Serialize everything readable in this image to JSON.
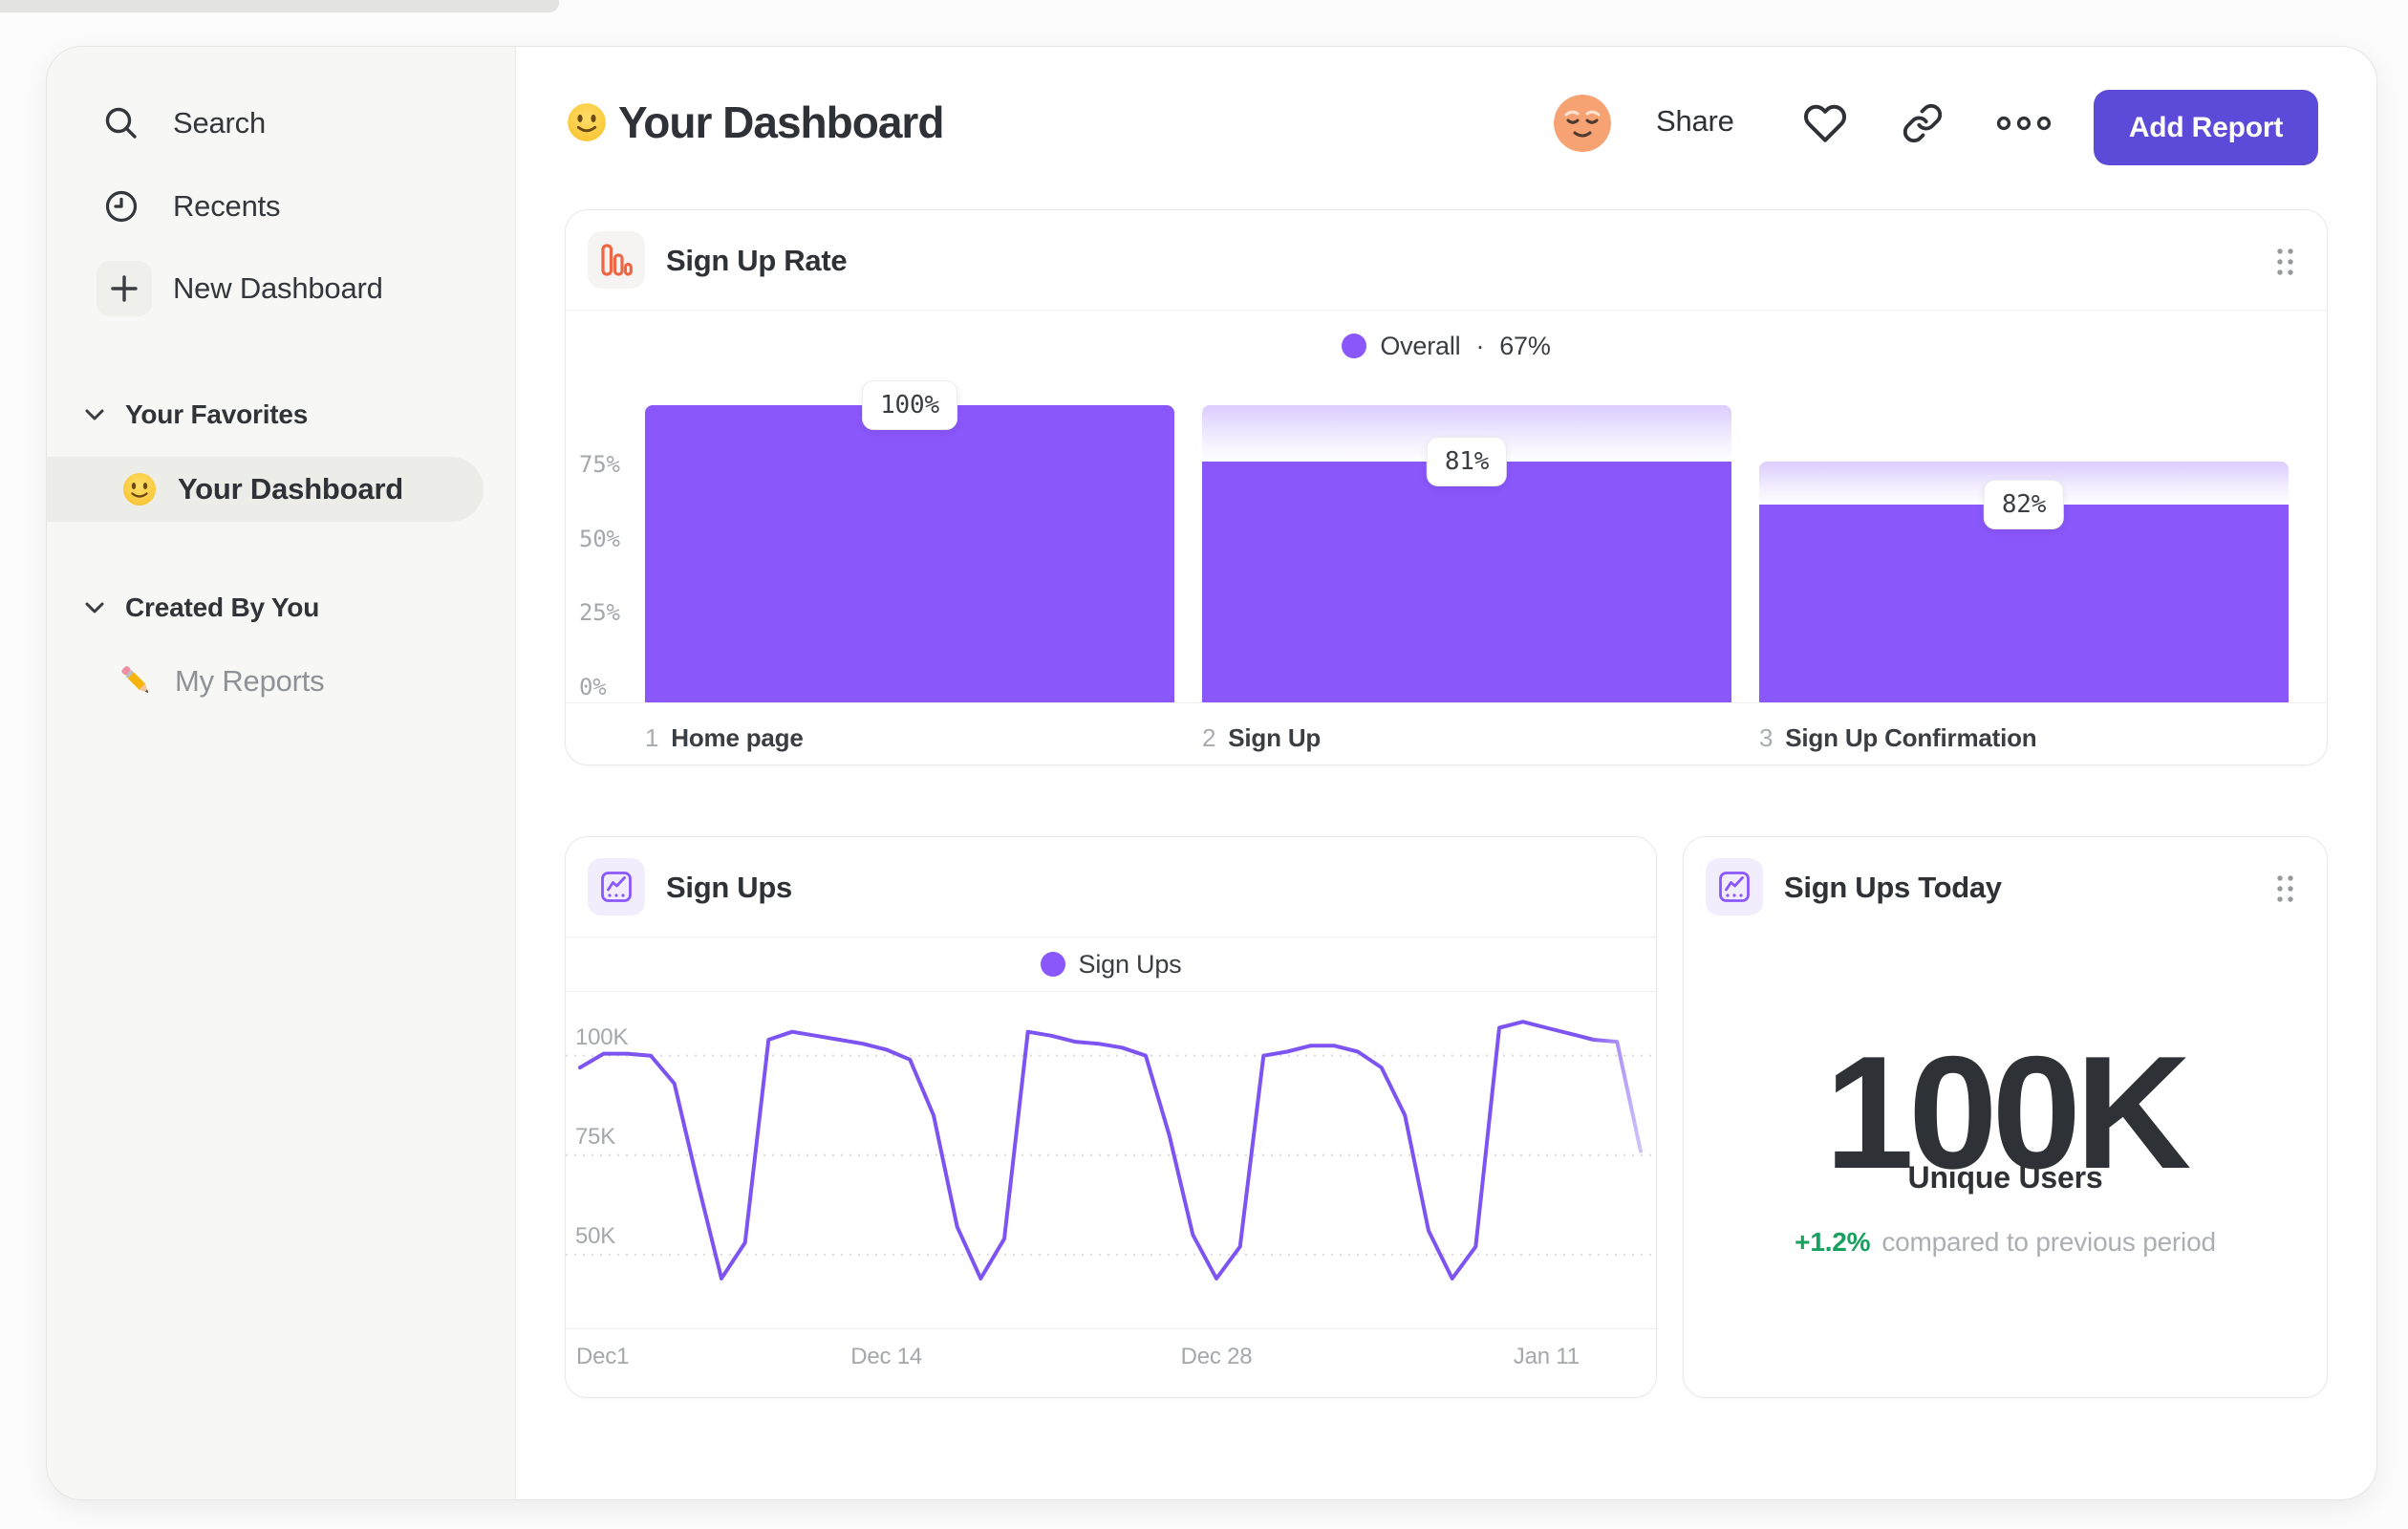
{
  "header": {
    "title": "Your Dashboard",
    "title_emoji": "slightly-smiling-face",
    "share": "Share",
    "add_report": "Add Report"
  },
  "sidebar": {
    "top_items": [
      {
        "icon": "search-icon",
        "label": "Search"
      },
      {
        "icon": "clock-icon",
        "label": "Recents"
      },
      {
        "icon": "plus-icon",
        "label": "New Dashboard"
      }
    ],
    "sections": [
      {
        "title": "Your Favorites",
        "items": [
          {
            "icon": "slightly-smiling-face-emoji",
            "label": "Your Dashboard",
            "selected": true
          }
        ]
      },
      {
        "title": "Created By You",
        "items": [
          {
            "icon": "pencil-emoji",
            "label": "My Reports",
            "selected": false
          }
        ]
      }
    ]
  },
  "cards": {
    "funnel": {
      "title": "Sign Up Rate",
      "icon": "bar-chart-icon",
      "legend_label": "Overall",
      "legend_sep": "·",
      "legend_value": "67%"
    },
    "line": {
      "title": "Sign Ups",
      "icon": "line-chart-icon",
      "legend_label": "Sign Ups"
    },
    "stat": {
      "title": "Sign Ups Today",
      "icon": "line-chart-icon",
      "value": "100K",
      "value_label": "Unique Users",
      "delta": "+1.2%",
      "delta_note": "compared to previous period"
    }
  },
  "chart_data": [
    {
      "type": "bar",
      "title": "Sign Up Rate",
      "overall_conversion": "67%",
      "categories": [
        "Home page",
        "Sign Up",
        "Sign Up Confirmation"
      ],
      "step_numbers": [
        "1",
        "2",
        "3"
      ],
      "step_conversion_labels": [
        "100%",
        "81%",
        "82%"
      ],
      "bar_top_pct": [
        100,
        81,
        66.4
      ],
      "carryover_top_pct": [
        100,
        100,
        81
      ],
      "y_ticks": [
        {
          "label": "75%",
          "pct": 75
        },
        {
          "label": "50%",
          "pct": 50
        },
        {
          "label": "25%",
          "pct": 25
        },
        {
          "label": "0%",
          "pct": 0
        }
      ],
      "ylim": [
        0,
        100
      ],
      "bar_color": "#8A57FB",
      "legend_position": "top-center"
    },
    {
      "type": "line",
      "title": "Sign Ups",
      "series": [
        {
          "name": "Sign Ups",
          "unit": "K",
          "values": [
            97,
            100.5,
            100.5,
            100,
            93,
            68,
            44,
            53,
            104,
            106,
            105,
            104,
            103,
            101.5,
            99,
            85,
            57,
            44,
            54,
            106,
            105,
            103.5,
            103,
            102,
            100,
            80,
            55,
            44,
            52,
            100,
            101,
            102.5,
            102.5,
            101,
            97,
            85,
            56,
            44,
            52,
            107,
            108.5,
            107,
            105.5,
            104,
            103.5,
            76
          ]
        }
      ],
      "x_ticks": [
        {
          "label": "Dec1",
          "day": 0,
          "align": "left"
        },
        {
          "label": "Dec 14",
          "day": 13,
          "align": "center"
        },
        {
          "label": "Dec 28",
          "day": 27,
          "align": "center"
        },
        {
          "label": "Jan 11",
          "day": 41,
          "align": "center"
        }
      ],
      "y_gridlines": [
        {
          "label": "100K",
          "value": 100
        },
        {
          "label": "75K",
          "value": 75
        },
        {
          "label": "50K",
          "value": 50
        }
      ],
      "ylim": [
        31.5,
        116
      ],
      "grid": "dashed",
      "line_color": "#7D53F2",
      "legend_position": "top-center"
    }
  ]
}
